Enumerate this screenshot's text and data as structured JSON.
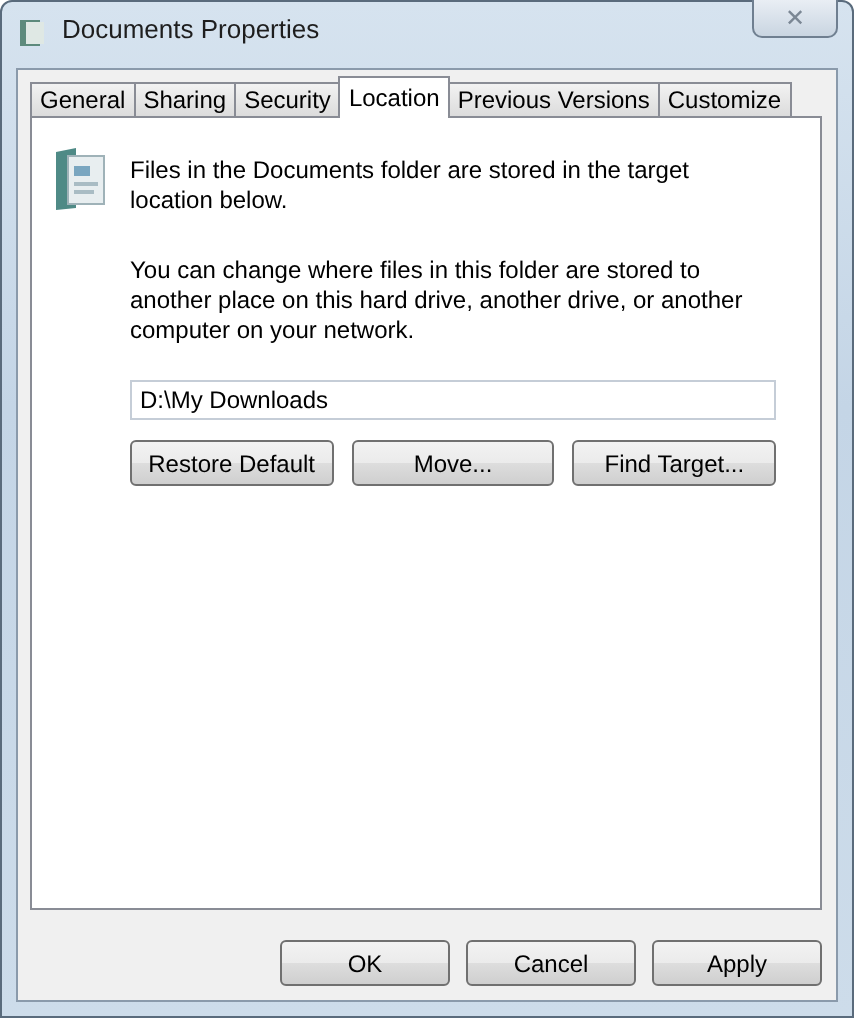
{
  "window": {
    "title": "Documents Properties",
    "close": "✕"
  },
  "tabs": [
    {
      "label": "General",
      "selected": false
    },
    {
      "label": "Sharing",
      "selected": false
    },
    {
      "label": "Security",
      "selected": false
    },
    {
      "label": "Location",
      "selected": true
    },
    {
      "label": "Previous Versions",
      "selected": false
    },
    {
      "label": "Customize",
      "selected": false
    }
  ],
  "intro": "Files in the Documents folder are stored in the target location below.",
  "description": "You can change where files in this folder are stored to another place on this hard drive, another drive, or another computer on your network.",
  "path": {
    "value": "D:\\My Downloads"
  },
  "location_buttons": [
    "Restore Default",
    "Move...",
    "Find Target..."
  ],
  "dialog_buttons": [
    "OK",
    "Cancel",
    "Apply"
  ]
}
